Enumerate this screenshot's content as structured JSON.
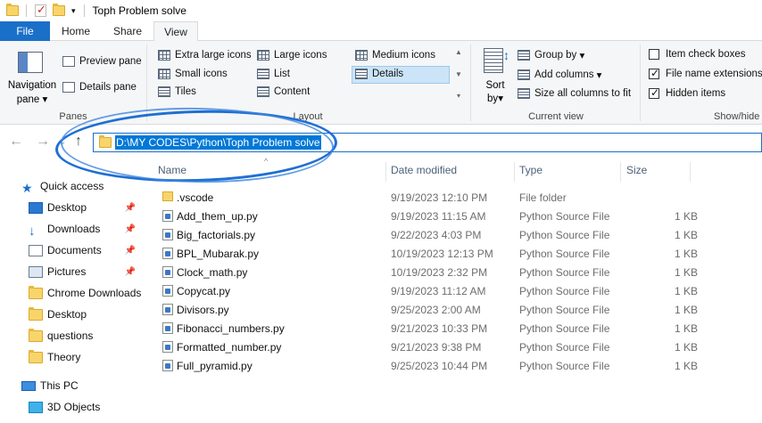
{
  "window": {
    "title": "Toph Problem solve"
  },
  "tabs": [
    "File",
    "Home",
    "Share",
    "View"
  ],
  "ribbon": {
    "panes": {
      "navigation_pane": "Navigation",
      "navigation_pane2": "pane",
      "preview_pane": "Preview pane",
      "details_pane": "Details pane",
      "label": "Panes"
    },
    "layout": {
      "label": "Layout",
      "items": [
        "Extra large icons",
        "Large icons",
        "Medium icons",
        "Small icons",
        "List",
        "Details",
        "Tiles",
        "Content"
      ]
    },
    "current_view": {
      "sort_by": "Sort",
      "sort_by2": "by",
      "group_by": "Group by",
      "add_columns": "Add columns",
      "size_all": "Size all columns to fit",
      "label": "Current view"
    },
    "show_hide": {
      "item_check_boxes": "Item check boxes",
      "file_name_extensions": "File name extensions",
      "hidden_items": "Hidden items",
      "label": "Show/hide"
    }
  },
  "address": {
    "path": "D:\\MY CODES\\Python\\Toph Problem solve"
  },
  "sidebar": {
    "items": [
      "Quick access",
      "Desktop",
      "Downloads",
      "Documents",
      "Pictures",
      "Chrome Downloads",
      "Desktop",
      "questions",
      "Theory",
      "This PC",
      "3D Objects"
    ]
  },
  "columns": {
    "name": "Name",
    "date": "Date modified",
    "type": "Type",
    "size": "Size"
  },
  "files": [
    {
      "name": ".vscode",
      "date": "9/19/2023 12:10 PM",
      "type": "File folder",
      "size": ""
    },
    {
      "name": "Add_them_up.py",
      "date": "9/19/2023 11:15 AM",
      "type": "Python Source File",
      "size": "1 KB"
    },
    {
      "name": "Big_factorials.py",
      "date": "9/22/2023 4:03 PM",
      "type": "Python Source File",
      "size": "1 KB"
    },
    {
      "name": "BPL_Mubarak.py",
      "date": "10/19/2023 12:13 PM",
      "type": "Python Source File",
      "size": "1 KB"
    },
    {
      "name": "Clock_math.py",
      "date": "10/19/2023 2:32 PM",
      "type": "Python Source File",
      "size": "1 KB"
    },
    {
      "name": "Copycat.py",
      "date": "9/19/2023 11:12 AM",
      "type": "Python Source File",
      "size": "1 KB"
    },
    {
      "name": "Divisors.py",
      "date": "9/25/2023 2:00 AM",
      "type": "Python Source File",
      "size": "1 KB"
    },
    {
      "name": "Fibonacci_numbers.py",
      "date": "9/21/2023 10:33 PM",
      "type": "Python Source File",
      "size": "1 KB"
    },
    {
      "name": "Formatted_number.py",
      "date": "9/21/2023 9:38 PM",
      "type": "Python Source File",
      "size": "1 KB"
    },
    {
      "name": "Full_pyramid.py",
      "date": "9/25/2023 10:44 PM",
      "type": "Python Source File",
      "size": "1 KB"
    }
  ]
}
